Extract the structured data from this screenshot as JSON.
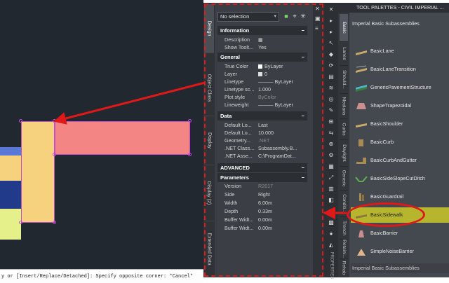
{
  "canvas": {
    "command_line": "y or [Insert/Replace/Detached]: Specify opposite corner: *Cancel*"
  },
  "properties": {
    "selection": "No selection",
    "tabs": [
      "Design",
      "Object Class",
      "Display",
      "Display (2)",
      "Extended Data"
    ],
    "sections": {
      "information": {
        "title": "Information",
        "rows": [
          {
            "key": "Description",
            "value": "▦"
          },
          {
            "key": "Show Toolt...",
            "value": "Yes"
          }
        ]
      },
      "general": {
        "title": "General",
        "rows": [
          {
            "key": "True Color",
            "value": "ByLayer"
          },
          {
            "key": "Layer",
            "value": "0"
          },
          {
            "key": "Linetype",
            "value": "——— ByLayer"
          },
          {
            "key": "Linetype sc...",
            "value": "1.000"
          },
          {
            "key": "Plot style",
            "value": "ByColor"
          },
          {
            "key": "Lineweight",
            "value": "——— ByLayer"
          }
        ]
      },
      "data": {
        "title": "Data",
        "rows": [
          {
            "key": "Default Lo...",
            "value": "Last"
          },
          {
            "key": "Default Lo...",
            "value": "10.000"
          },
          {
            "key": "Geometry...",
            "value": ".NET"
          },
          {
            "key": ".NET Class...",
            "value": "Subassembly.B..."
          },
          {
            "key": ".NET Asse...",
            "value": "C:\\ProgramDat..."
          }
        ]
      },
      "advanced": {
        "title": "ADVANCED"
      },
      "parameters": {
        "title": "Parameters",
        "rows": [
          {
            "key": "Version",
            "value": "R2017"
          },
          {
            "key": "Side",
            "value": "Right"
          },
          {
            "key": "Width",
            "value": "6.00m"
          },
          {
            "key": "Depth",
            "value": "0.33m"
          },
          {
            "key": "Buffer Widt...",
            "value": "0.00m"
          },
          {
            "key": "Buffer Widt...",
            "value": "0.00m"
          }
        ]
      }
    },
    "collapse_glyph": "−"
  },
  "tool_palettes": {
    "title": "TOOL PALETTES - CIVIL IMPERIAL ...",
    "header": "Imperial Basic Subassemblies",
    "footer": "Imperial Basic Subassemblies",
    "tabs": [
      "Basic",
      "Lanes",
      "Should...",
      "Medians",
      "Curbs",
      "Daylight",
      "Generic",
      "Conditi...",
      "Trench",
      "Retaini...",
      "Rehab"
    ],
    "items": [
      {
        "label": "BasicLane",
        "icon": "lane-icon"
      },
      {
        "label": "BasicLaneTransition",
        "icon": "lane-transition-icon"
      },
      {
        "label": "GenericPavementStructure",
        "icon": "pavement-icon"
      },
      {
        "label": "ShapeTrapezoidal",
        "icon": "trapezoid-icon"
      },
      {
        "label": "BasicShoulder",
        "icon": "shoulder-icon"
      },
      {
        "label": "BasicCurb",
        "icon": "curb-icon"
      },
      {
        "label": "BasicCurbAndGutter",
        "icon": "curb-gutter-icon"
      },
      {
        "label": "BasicSideSlopeCutDitch",
        "icon": "ditch-icon"
      },
      {
        "label": "BasicGuardrail",
        "icon": "guardrail-icon"
      },
      {
        "label": "BasicSidewalk",
        "icon": "sidewalk-icon",
        "selected": true
      },
      {
        "label": "BasicBarrier",
        "icon": "barrier-icon"
      },
      {
        "label": "SimpleNoiseBarrier",
        "icon": "noise-barrier-icon"
      }
    ]
  },
  "middle_toolbar": {
    "label": "PROPERTIES"
  },
  "colors": {
    "highlight_red": "#e01818",
    "sidewalk_fill": "#f38585",
    "shoulder_fill": "#f7d27e",
    "selected_item": "#b7b52e"
  }
}
